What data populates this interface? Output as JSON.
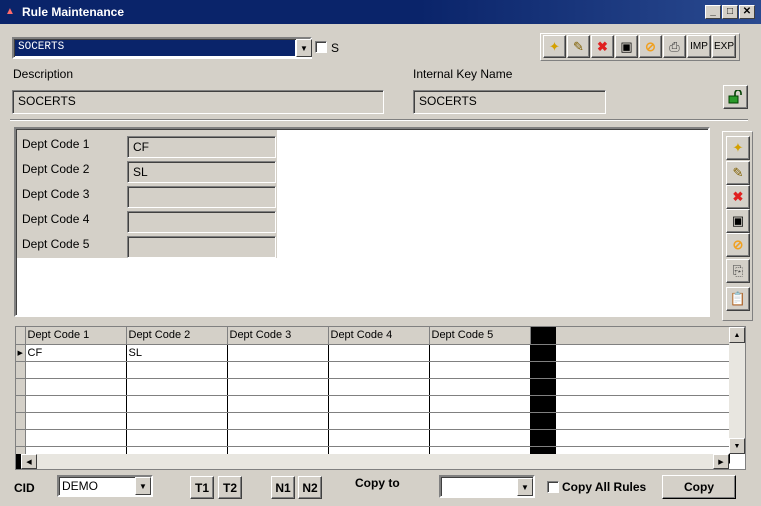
{
  "window": {
    "title": "Rule Maintenance",
    "icon": "app-icon",
    "controls": [
      "_",
      "□",
      "✕"
    ]
  },
  "rule_selector": {
    "value": "SOCERTS",
    "checkbox_label": "S"
  },
  "toolbar": {
    "items": [
      {
        "name": "new-icon",
        "glyph": "✦"
      },
      {
        "name": "edit-icon",
        "glyph": "✎"
      },
      {
        "name": "delete-icon",
        "glyph": "✖"
      },
      {
        "name": "save-icon",
        "glyph": "▣"
      },
      {
        "name": "cancel-icon",
        "glyph": "⊘"
      },
      {
        "name": "print-icon",
        "glyph": "⎙"
      }
    ],
    "imp_label": "IMP",
    "exp_label": "EXP"
  },
  "description": {
    "label": "Description",
    "value": "SOCERTS"
  },
  "internal_key": {
    "label": "Internal Key Name",
    "value": "SOCERTS"
  },
  "dept_fields": [
    {
      "label": "Dept Code 1",
      "value": "CF"
    },
    {
      "label": "Dept Code 2",
      "value": "SL"
    },
    {
      "label": "Dept Code 3",
      "value": ""
    },
    {
      "label": "Dept Code 4",
      "value": ""
    },
    {
      "label": "Dept Code 5",
      "value": ""
    }
  ],
  "grid": {
    "columns": [
      "Dept Code 1",
      "Dept Code 2",
      "Dept Code 3",
      "Dept Code 4",
      "Dept Code 5"
    ],
    "rows": [
      [
        "CF",
        "SL",
        "",
        "",
        ""
      ]
    ]
  },
  "footer": {
    "cid_label": "CID",
    "cid_value": "DEMO",
    "t1": "T1",
    "t2": "T2",
    "n1": "N1",
    "n2": "N2",
    "copy_to_label": "Copy to",
    "copy_to_value": "",
    "copy_all_label": "Copy All Rules",
    "copy_button": "Copy"
  },
  "colors": {
    "title_bar": "#0a246a",
    "window_bg": "#d4d0c8",
    "selection": "#0a246a",
    "delete_red": "#e02020",
    "cancel_orange": "#f0a020",
    "lock_green": "#2a9a2a"
  }
}
